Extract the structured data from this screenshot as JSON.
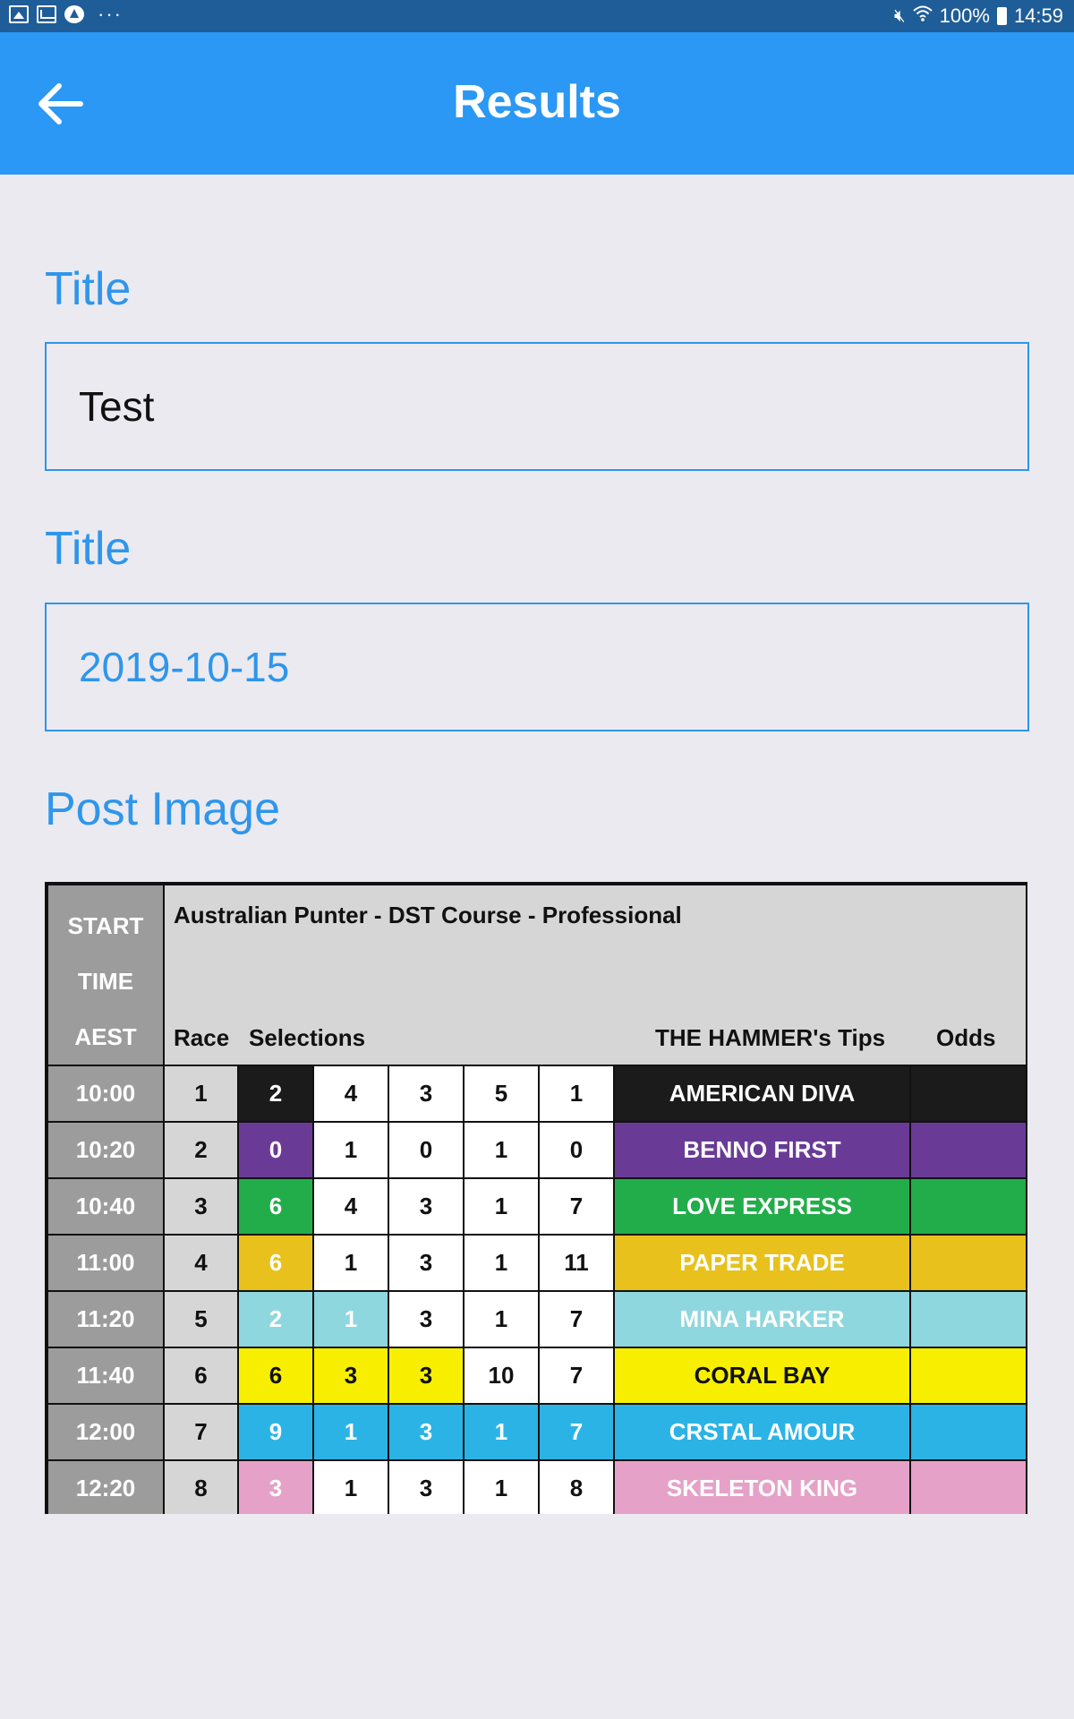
{
  "status_bar": {
    "battery": "100%",
    "time": "14:59",
    "dots": "···"
  },
  "app_bar": {
    "title": "Results"
  },
  "form": {
    "title_label": "Title",
    "title_value": "Test",
    "date_label": "Title",
    "date_value": "2019-10-15",
    "image_label": "Post Image"
  },
  "post_image": {
    "header": {
      "start_time": [
        "START",
        "TIME",
        "AEST"
      ],
      "title": "Australian Punter - DST Course - Professional",
      "race": "Race",
      "selections": "Selections",
      "tips": "THE HAMMER's Tips",
      "odds": "Odds"
    },
    "rows": [
      {
        "time": "10:00",
        "race": "1",
        "sel": [
          "2",
          "4",
          "3",
          "5",
          "1"
        ],
        "tip": "AMERICAN DIVA",
        "color": "#1b1b1b",
        "text": "#ffffff",
        "filled": 1
      },
      {
        "time": "10:20",
        "race": "2",
        "sel": [
          "0",
          "1",
          "0",
          "1",
          "0"
        ],
        "tip": "BENNO FIRST",
        "color": "#6a3b96",
        "text": "#ffffff",
        "filled": 1
      },
      {
        "time": "10:40",
        "race": "3",
        "sel": [
          "6",
          "4",
          "3",
          "1",
          "7"
        ],
        "tip": "LOVE EXPRESS",
        "color": "#22ad4a",
        "text": "#ffffff",
        "filled": 1
      },
      {
        "time": "11:00",
        "race": "4",
        "sel": [
          "6",
          "1",
          "3",
          "1",
          "11"
        ],
        "tip": "PAPER TRADE",
        "color": "#e8c11c",
        "text": "#ffffff",
        "filled": 1
      },
      {
        "time": "11:20",
        "race": "5",
        "sel": [
          "2",
          "1",
          "3",
          "1",
          "7"
        ],
        "tip": "MINA HARKER",
        "color": "#8fd7de",
        "text": "#ffffff",
        "filled": 2
      },
      {
        "time": "11:40",
        "race": "6",
        "sel": [
          "6",
          "3",
          "3",
          "10",
          "7"
        ],
        "tip": "CORAL BAY",
        "color": "#f8ef00",
        "text": "#111111",
        "filled": 3
      },
      {
        "time": "12:00",
        "race": "7",
        "sel": [
          "9",
          "1",
          "3",
          "1",
          "7"
        ],
        "tip": "CRSTAL AMOUR",
        "color": "#2cb3e6",
        "text": "#ffffff",
        "filled": 5
      },
      {
        "time": "12:20",
        "race": "8",
        "sel": [
          "3",
          "1",
          "3",
          "1",
          "8"
        ],
        "tip": "SKELETON KING",
        "color": "#e5a1c8",
        "text": "#ffffff",
        "filled": 1
      }
    ]
  }
}
